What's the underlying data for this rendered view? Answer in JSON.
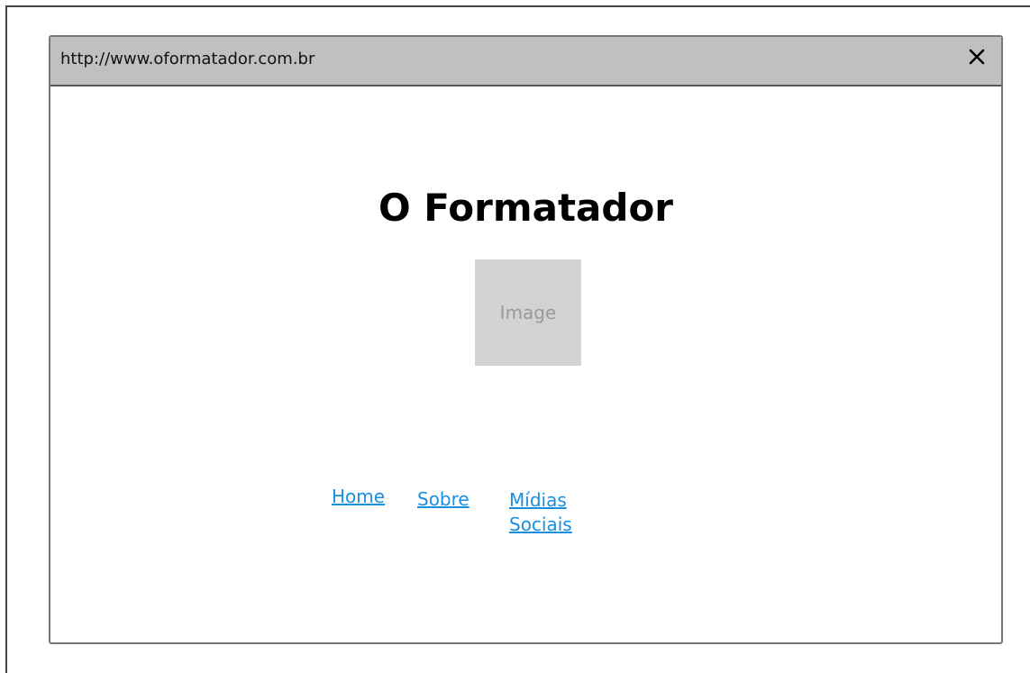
{
  "window": {
    "url": "http://www.oformatador.com.br",
    "close_icon": "close-icon"
  },
  "page": {
    "title": "O Formatador",
    "image_placeholder": "Image"
  },
  "nav": {
    "links": [
      {
        "label": "Home"
      },
      {
        "label": "Sobre"
      },
      {
        "label": "Mídias Sociais"
      }
    ]
  },
  "colors": {
    "titlebar": "#c0c0c0",
    "link": "#1a8fe0",
    "image_placeholder_bg": "#d3d3d3"
  }
}
